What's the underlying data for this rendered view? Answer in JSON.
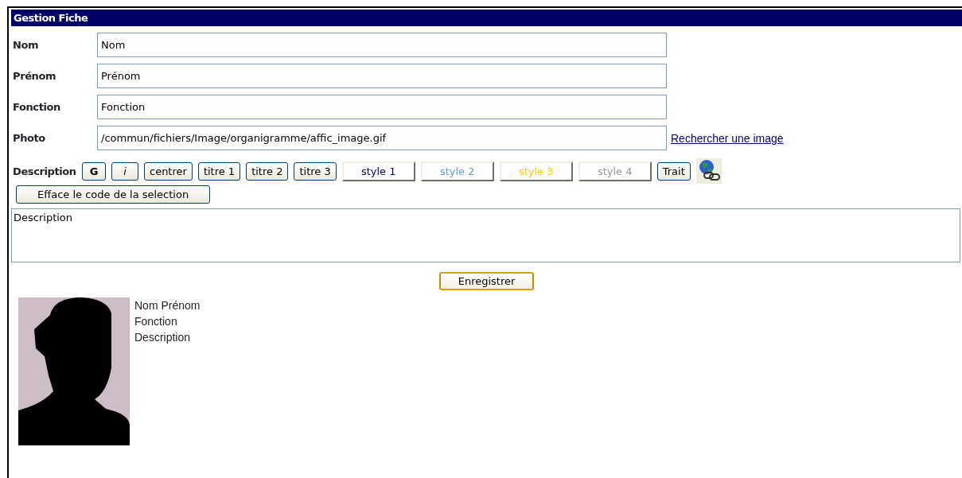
{
  "panel": {
    "title": "Gestion Fiche"
  },
  "fields": [
    {
      "label": "Nom",
      "value": "Nom"
    },
    {
      "label": "Prénom",
      "value": "Prénom"
    },
    {
      "label": "Fonction",
      "value": "Fonction"
    },
    {
      "label": "Photo",
      "value": "/commun/fichiers/Image/organigramme/affic_image.gif",
      "link": "Rechercher une image"
    }
  ],
  "description": {
    "label": "Description",
    "toolbar": [
      {
        "kind": "bold",
        "label": "G"
      },
      {
        "kind": "italic",
        "label": "i"
      },
      {
        "kind": "plain",
        "label": "centrer"
      },
      {
        "kind": "plain",
        "label": "titre 1"
      },
      {
        "kind": "plain",
        "label": "titre 2"
      },
      {
        "kind": "plain",
        "label": "titre 3"
      },
      {
        "kind": "style",
        "label": "style 1",
        "color": "#000066"
      },
      {
        "kind": "style",
        "label": "style 2",
        "color": "#6699cc"
      },
      {
        "kind": "style",
        "label": "style 3",
        "color": "#ffcc00"
      },
      {
        "kind": "style",
        "label": "style 4",
        "color": "#999999"
      },
      {
        "kind": "plain",
        "label": "Trait"
      },
      {
        "kind": "link-icon"
      }
    ],
    "clear_button": "Efface le code de la selection",
    "value": "Description"
  },
  "save_button": "Enregistrer",
  "preview": {
    "lines": [
      "Nom Prénom",
      "Fonction",
      "Description"
    ]
  }
}
